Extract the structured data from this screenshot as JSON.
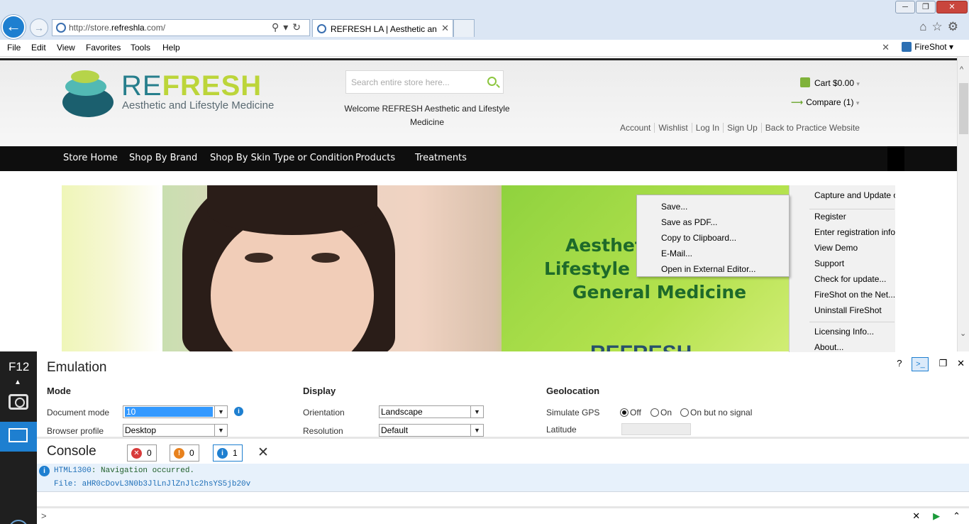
{
  "browser": {
    "address": "http://store.refreshla.com/",
    "address_domain_prefix": "http://store.",
    "address_domain": "refreshla",
    "address_domain_suffix": ".com/",
    "tab_title": "REFRESH LA | Aesthetic an...",
    "menu": [
      "File",
      "Edit",
      "View",
      "Favorites",
      "Tools",
      "Help"
    ],
    "fireshot_label": "FireShot"
  },
  "site": {
    "logo_re": "RE",
    "logo_fresh": "FRESH",
    "logo_tagline": "Aesthetic and Lifestyle Medicine",
    "search_placeholder": "Search entire store here...",
    "welcome": "Welcome REFRESH Aesthetic and Lifestyle Medicine",
    "cart": "Cart $0.00",
    "compare": "Compare (1)",
    "top_links": [
      "Account",
      "Wishlist",
      "Log In",
      "Sign Up",
      "Back to Practice Website"
    ],
    "nav": [
      "Store Home",
      "Shop By Brand",
      "Shop By Skin Type or Condition",
      "Products",
      "Treatments"
    ],
    "banner_line1": "Aesthet",
    "banner_line2": "Lifestyle",
    "banner_line3": "General Medicine",
    "banner_logo": "REFRESH"
  },
  "fireshot_menu": {
    "items": [
      "Save...",
      "Save as PDF...",
      "Copy to Clipboard...",
      "E-Mail...",
      "Open in External Editor..."
    ],
    "side_items": [
      "Capture and Update o",
      "Register",
      "Enter registration info...",
      "View Demo",
      "Support",
      "Check for update...",
      "FireShot on the Net...",
      "Uninstall FireShot",
      "Licensing Info...",
      "About..."
    ]
  },
  "devtools": {
    "f12_label": "F12",
    "emulation_title": "Emulation",
    "mode_heading": "Mode",
    "display_heading": "Display",
    "geo_heading": "Geolocation",
    "document_mode_label": "Document mode",
    "document_mode_value": "10",
    "browser_profile_label": "Browser profile",
    "browser_profile_value": "Desktop",
    "orientation_label": "Orientation",
    "orientation_value": "Landscape",
    "resolution_label": "Resolution",
    "resolution_value": "Default",
    "simulate_gps_label": "Simulate GPS",
    "gps_options": [
      "Off",
      "On",
      "On but no signal"
    ],
    "latitude_label": "Latitude",
    "console_title": "Console",
    "errors": "0",
    "warnings": "0",
    "infos": "1",
    "msg_code": "HTML1300",
    "msg_text": ": Navigation occurred.",
    "msg_file": "File: aHR0cDovL3N0b3JlLnJlZnJlc2hsYS5jb20v"
  }
}
